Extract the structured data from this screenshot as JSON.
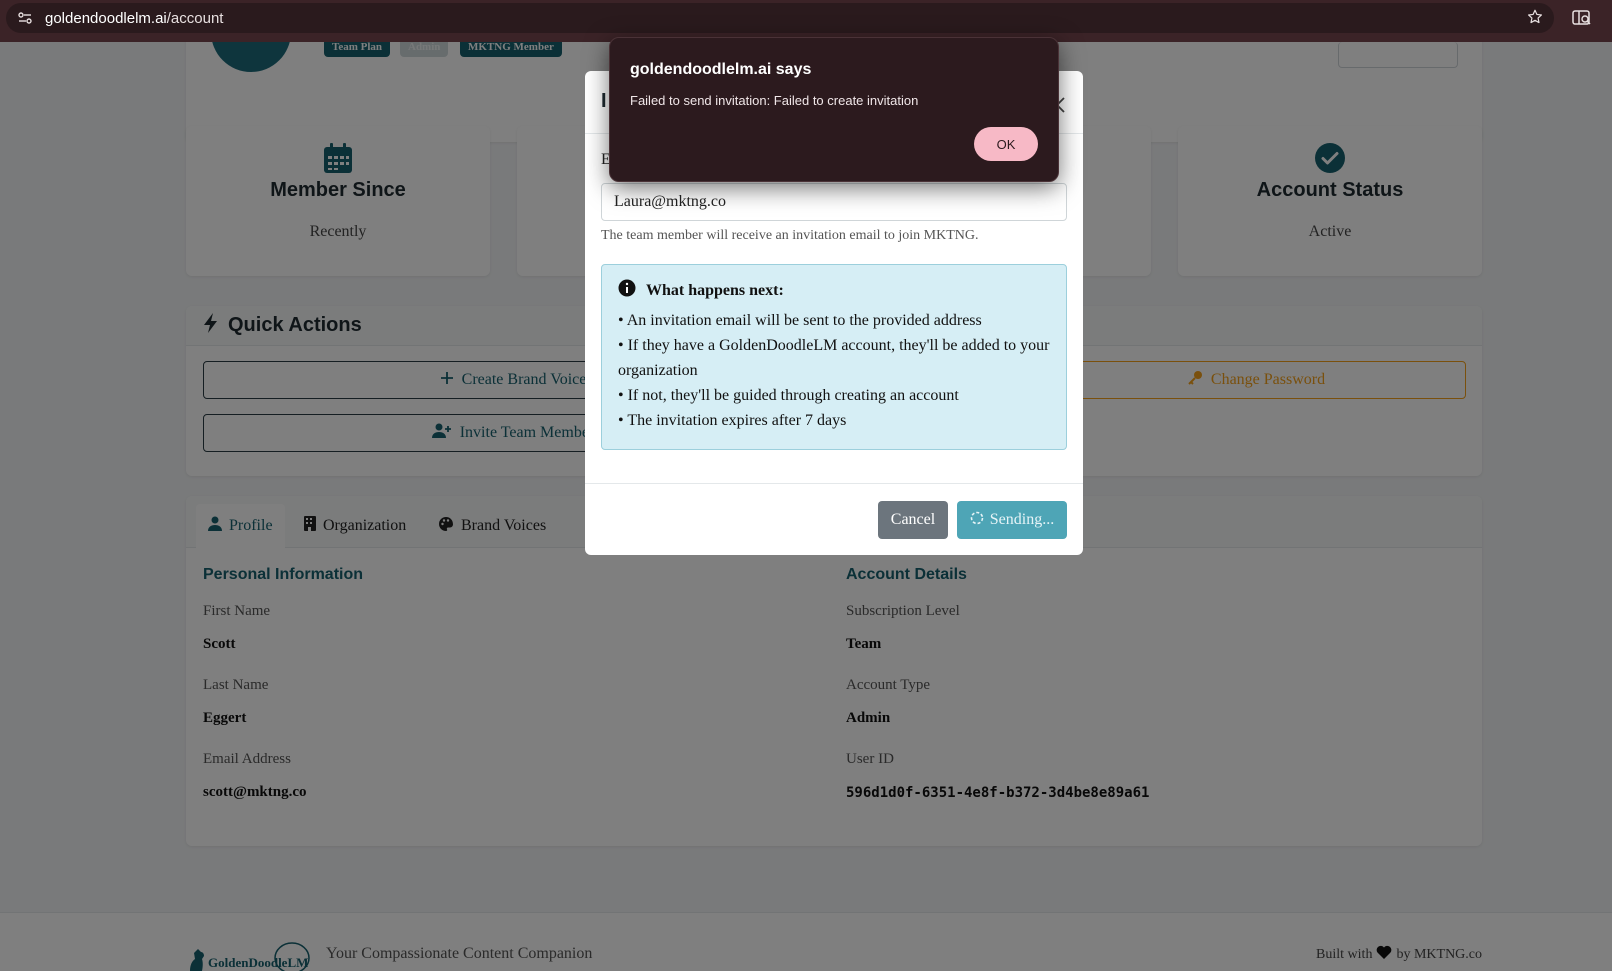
{
  "browser": {
    "url_domain": "goldendoodlelm.ai",
    "url_path": "/account",
    "site_info_icon": "tune-icon",
    "bookmark_icon": "star-icon",
    "side_panel_icon": "side-search-icon"
  },
  "profile": {
    "badges": [
      "Team Plan",
      "Admin",
      "MKTNG Member"
    ]
  },
  "stats": [
    {
      "icon": "calendar-icon",
      "title": "Member Since",
      "value": "Recently"
    },
    {
      "icon": "check-circle-icon",
      "title": "Account Status",
      "value": "Active"
    }
  ],
  "quick_actions": {
    "title": "Quick Actions",
    "create_brand_voice": "Create Brand Voice",
    "invite_team_member": "Invite Team Member",
    "change_password": "Change Password"
  },
  "tabs": [
    "Profile",
    "Organization",
    "Brand Voices"
  ],
  "personal": {
    "title": "Personal Information",
    "first_name_label": "First Name",
    "first_name": "Scott",
    "last_name_label": "Last Name",
    "last_name": "Eggert",
    "email_label": "Email Address",
    "email": "scott@mktng.co"
  },
  "account": {
    "title": "Account Details",
    "subscription_label": "Subscription Level",
    "subscription": "Team",
    "type_label": "Account Type",
    "type": "Admin",
    "user_id_label": "User ID",
    "user_id": "596d1d0f-6351-4e8f-b372-3d4be8e89a61"
  },
  "footer": {
    "logo_text": "GoldenDoodleLM",
    "tagline": "Your Compassionate Content Companion",
    "built_with": "Built with",
    "by": "by MKTNG.co"
  },
  "modal": {
    "title_partial": "I",
    "email_label_partial": "E",
    "email_value": "Laura@mktng.co",
    "help_text": "The team member will receive an invitation email to join MKTNG.",
    "info_title": "What happens next:",
    "info_lines": [
      "• An invitation email will be sent to the provided address",
      "• If they have a GoldenDoodleLM account, they'll be added to your organization",
      "• If not, they'll be guided through creating an account",
      "• The invitation expires after 7 days"
    ],
    "cancel": "Cancel",
    "sending": "Sending..."
  },
  "alert": {
    "title": "goldendoodlelm.ai says",
    "message": "Failed to send invitation: Failed to create invitation",
    "ok": "OK"
  }
}
